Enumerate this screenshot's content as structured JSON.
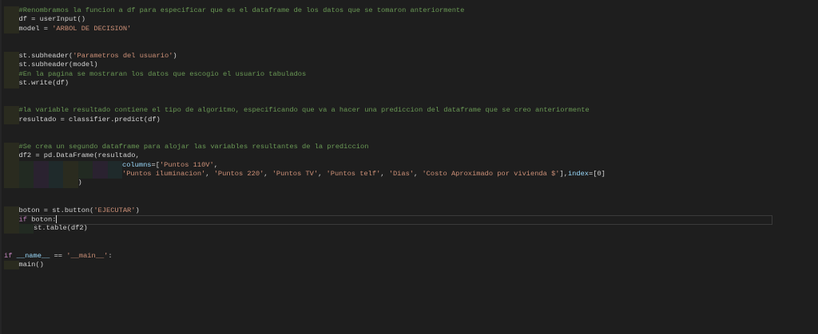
{
  "editor": {
    "colors": {
      "background": "#1e1e1e",
      "comment": "#6a9955",
      "string": "#ce9178",
      "plain": "#d4d4d4"
    },
    "cursor_line": 24,
    "lines": [
      {
        "indent": 1,
        "tokens": [
          [
            "#Renombramos la funcion a df para especificar que es el dataframe de los datos que se tomaron anteriormente",
            "comment"
          ]
        ]
      },
      {
        "indent": 1,
        "tokens": [
          [
            "df = userInput()",
            "plain"
          ]
        ]
      },
      {
        "indent": 1,
        "tokens": [
          [
            "model = ",
            "plain"
          ],
          [
            "'ARBOL DE DECISION'",
            "string"
          ]
        ]
      },
      {
        "indent": 0,
        "tokens": []
      },
      {
        "indent": 0,
        "tokens": []
      },
      {
        "indent": 1,
        "tokens": [
          [
            "st.subheader(",
            "plain"
          ],
          [
            "'Parametros del usuario'",
            "string"
          ],
          [
            ")",
            "plain"
          ]
        ]
      },
      {
        "indent": 1,
        "tokens": [
          [
            "st.subheader(model)",
            "plain"
          ]
        ]
      },
      {
        "indent": 1,
        "tokens": [
          [
            "#En la pagina se mostraran los datos que escogio el usuario tabulados",
            "comment"
          ]
        ]
      },
      {
        "indent": 1,
        "tokens": [
          [
            "st.write(df)",
            "plain"
          ]
        ]
      },
      {
        "indent": 0,
        "tokens": []
      },
      {
        "indent": 0,
        "tokens": []
      },
      {
        "indent": 1,
        "tokens": [
          [
            "#la variable resultado contiene el tipo de algoritmo, especificando que va a hacer una prediccion del dataframe que se creo anteriormente",
            "comment"
          ]
        ]
      },
      {
        "indent": 1,
        "tokens": [
          [
            "resultado = classifier.predict(df)",
            "plain"
          ]
        ]
      },
      {
        "indent": 0,
        "tokens": []
      },
      {
        "indent": 0,
        "tokens": []
      },
      {
        "indent": 1,
        "tokens": [
          [
            "#Se crea un segundo dataframe para alojar las variables resultantes de la prediccion",
            "comment"
          ]
        ]
      },
      {
        "indent": 1,
        "tokens": [
          [
            "df2 = pd.DataFrame(resultado,",
            "plain"
          ]
        ]
      },
      {
        "indent": 8,
        "tokens": [
          [
            "columns",
            "var"
          ],
          [
            "=[",
            "plain"
          ],
          [
            "'Puntos 110V'",
            "string"
          ],
          [
            ",",
            "plain"
          ]
        ]
      },
      {
        "indent": 8,
        "tokens": [
          [
            "'Puntos iluminacion'",
            "string"
          ],
          [
            ", ",
            "plain"
          ],
          [
            "'Puntos 220'",
            "string"
          ],
          [
            ", ",
            "plain"
          ],
          [
            "'Puntos TV'",
            "string"
          ],
          [
            ", ",
            "plain"
          ],
          [
            "'Puntos telf'",
            "string"
          ],
          [
            ", ",
            "plain"
          ],
          [
            "'Dias'",
            "string"
          ],
          [
            ", ",
            "plain"
          ],
          [
            "'Costo Aproximado por vivienda $'",
            "string"
          ],
          [
            "],",
            "plain"
          ],
          [
            "index",
            "var"
          ],
          [
            "=[0]",
            "plain"
          ]
        ]
      },
      {
        "indent": 5,
        "tokens": [
          [
            ")",
            "plain"
          ]
        ]
      },
      {
        "indent": 0,
        "tokens": []
      },
      {
        "indent": 0,
        "tokens": []
      },
      {
        "indent": 1,
        "tokens": [
          [
            "boton = st.button(",
            "plain"
          ],
          [
            "'EJECUTAR'",
            "string"
          ],
          [
            ")",
            "plain"
          ]
        ]
      },
      {
        "indent": 1,
        "tokens": [
          [
            "if",
            "keyword"
          ],
          [
            " boton:",
            "plain"
          ]
        ]
      },
      {
        "indent": 2,
        "tokens": [
          [
            "st.table(df2)",
            "plain"
          ]
        ]
      },
      {
        "indent": 0,
        "tokens": []
      },
      {
        "indent": 0,
        "tokens": []
      },
      {
        "indent": 0,
        "tokens": [
          [
            "if",
            "keyword"
          ],
          [
            " ",
            "plain"
          ],
          [
            "__name__",
            "var"
          ],
          [
            " == ",
            "plain"
          ],
          [
            "'__main__'",
            "string"
          ],
          [
            ":",
            "plain"
          ]
        ]
      },
      {
        "indent": 1,
        "tokens": [
          [
            "main()",
            "plain"
          ]
        ]
      }
    ]
  }
}
